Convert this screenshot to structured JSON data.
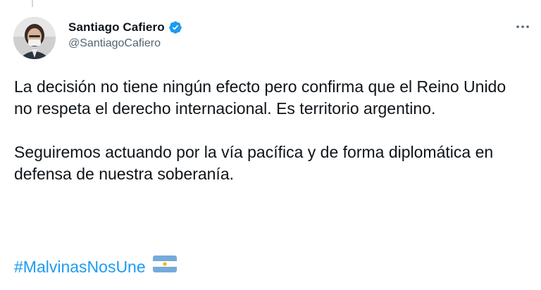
{
  "tweet": {
    "author": {
      "display_name": "Santiago Cafiero",
      "handle": "@SantiagoCafiero",
      "verified": true,
      "avatar_icon": "profile-photo"
    },
    "more_icon": "ellipsis-icon",
    "paragraphs": [
      "La decisión no tiene ningún efecto pero confirma que el Reino Unido no respeta el derecho internacional. Es territorio argentino.",
      "Seguiremos actuando por la vía pacífica y de forma diplomática en defensa de nuestra soberanía."
    ],
    "hashtag": "#MalvinasNosUne",
    "emoji": "argentina-flag-icon"
  },
  "colors": {
    "text": "#0f1419",
    "secondary_text": "#536471",
    "link": "#1d9bf0",
    "verified": "#1d9bf0"
  }
}
